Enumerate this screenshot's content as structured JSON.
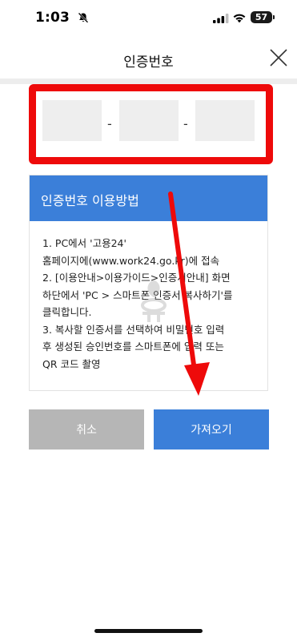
{
  "status_bar": {
    "time": "1:03",
    "battery": "57",
    "icons": [
      "bell-slash-icon",
      "signal-icon",
      "wifi-icon",
      "battery-icon"
    ]
  },
  "header": {
    "title": "인증번호",
    "close_icon": "close-icon"
  },
  "code_input": {
    "separator": "-",
    "fields": [
      {
        "value": "",
        "placeholder": ""
      },
      {
        "value": "",
        "placeholder": ""
      },
      {
        "value": "",
        "placeholder": ""
      }
    ],
    "highlight_color": "#ee0a0a"
  },
  "guide": {
    "title": "인증번호 이용방법",
    "accent_color": "#3b7fd9",
    "lines": [
      "1. PC에서 '고용24'",
      "홈페이지에(www.work24.go.kr)에 접속",
      "2. [이용안내>이용가이드>인증서안내] 화면",
      "하단에서 'PC > 스마트폰 인증서 복사하기'를",
      "클릭합니다.",
      "3. 복사할 인증서를 선택하여 비밀번호 입력",
      "후 생성된 승인번호를 스마트폰에 입력 또는",
      "QR 코드 촬영"
    ]
  },
  "buttons": {
    "cancel": "취소",
    "fetch": "가져오기"
  },
  "annotation": {
    "arrow_color": "#ee0a0a"
  }
}
